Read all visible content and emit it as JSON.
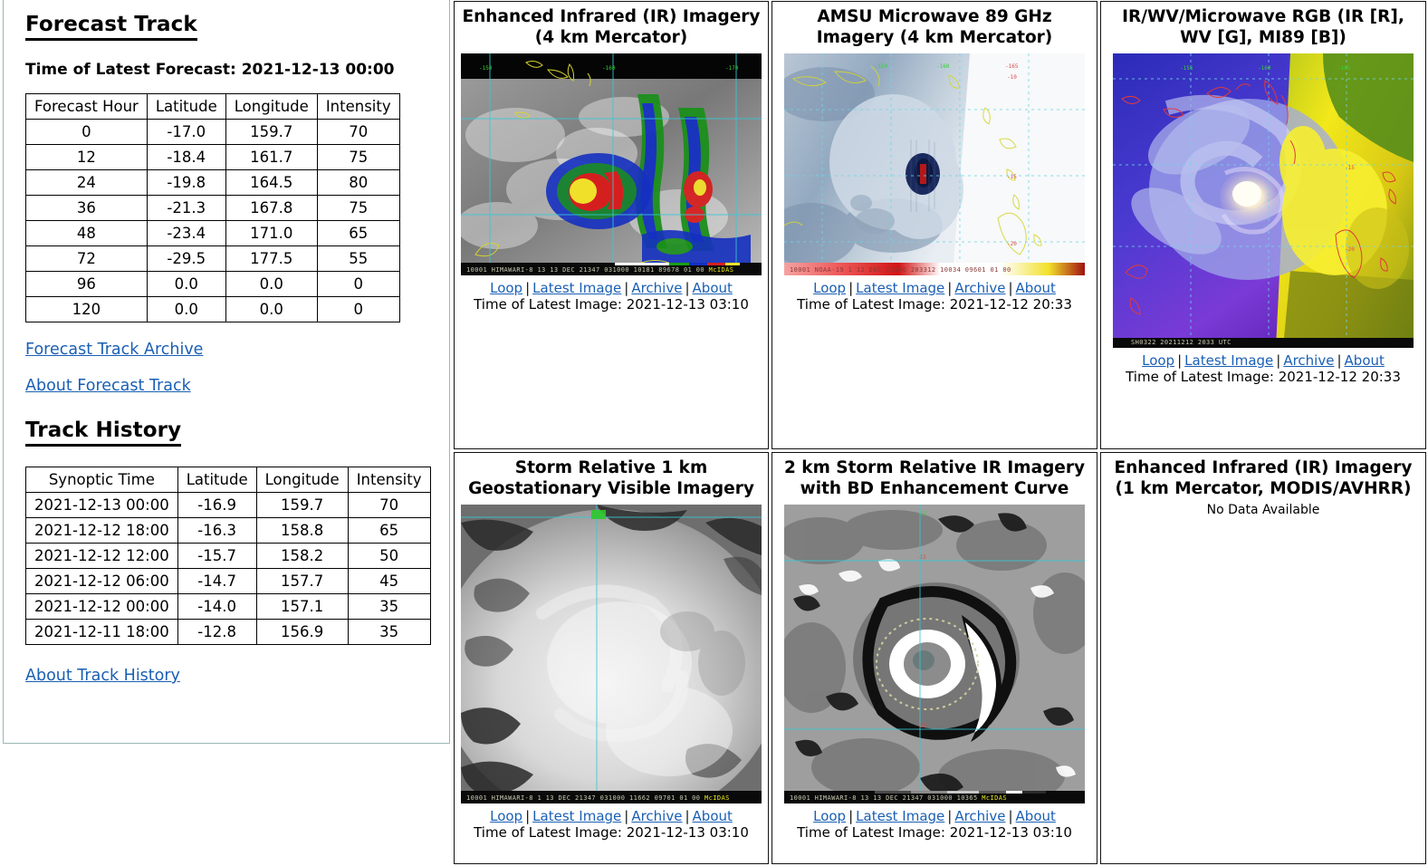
{
  "sidebar": {
    "forecast_track": {
      "heading": "Forecast Track",
      "latest_forecast_label": "Time of Latest Forecast: 2021-12-13 00:00",
      "columns": [
        "Forecast Hour",
        "Latitude",
        "Longitude",
        "Intensity"
      ],
      "rows": [
        [
          "0",
          "-17.0",
          "159.7",
          "70"
        ],
        [
          "12",
          "-18.4",
          "161.7",
          "75"
        ],
        [
          "24",
          "-19.8",
          "164.5",
          "80"
        ],
        [
          "36",
          "-21.3",
          "167.8",
          "75"
        ],
        [
          "48",
          "-23.4",
          "171.0",
          "65"
        ],
        [
          "72",
          "-29.5",
          "177.5",
          "55"
        ],
        [
          "96",
          "0.0",
          "0.0",
          "0"
        ],
        [
          "120",
          "0.0",
          "0.0",
          "0"
        ]
      ],
      "archive_link": "Forecast Track Archive",
      "about_link": "About Forecast Track"
    },
    "track_history": {
      "heading": "Track History",
      "columns": [
        "Synoptic Time",
        "Latitude",
        "Longitude",
        "Intensity"
      ],
      "rows": [
        [
          "2021-12-13 00:00",
          "-16.9",
          "159.7",
          "70"
        ],
        [
          "2021-12-12 18:00",
          "-16.3",
          "158.8",
          "65"
        ],
        [
          "2021-12-12 12:00",
          "-15.7",
          "158.2",
          "50"
        ],
        [
          "2021-12-12 06:00",
          "-14.7",
          "157.7",
          "45"
        ],
        [
          "2021-12-12 00:00",
          "-14.0",
          "157.1",
          "35"
        ],
        [
          "2021-12-11 18:00",
          "-12.8",
          "156.9",
          "35"
        ]
      ],
      "about_link": "About Track History"
    }
  },
  "common": {
    "loop_label": "Loop",
    "latest_image_label": "Latest Image",
    "archive_label": "Archive",
    "about_label": "About"
  },
  "panels": [
    {
      "id": "ir-4km",
      "title": "Enhanced Infrared (IR) Imagery (4 km Mercator)",
      "timestamp": "Time of Latest Image: 2021-12-13 03:10",
      "annotation": "10001 HIMAWARI-8 13 13 DEC 21347 031000 10181 89678 01 00",
      "annotation_suffix": "McIDAS",
      "lon_labels": [
        "-150",
        "-160",
        "-170"
      ],
      "has_data": true
    },
    {
      "id": "amsu-89ghz",
      "title": "AMSU Microwave 89 GHz Imagery (4 km Mercator)",
      "timestamp": "Time of Latest Image: 2021-12-12 20:33",
      "annotation": "10001 NOAA-19   1 12 DEC 21346 203312 10034 09601 01 00",
      "annotation_suffix": "",
      "lon_labels": [
        "-150",
        "-160"
      ],
      "lat_labels": [
        "-165",
        "-10",
        "-15",
        "-20"
      ],
      "has_data": true
    },
    {
      "id": "rgb-ir-wv-mi89",
      "title": "IR/WV/Microwave RGB (IR [R], WV [G], MI89 [B])",
      "timestamp": "Time of Latest Image: 2021-12-12 20:33",
      "annotation": "SH0322 20211212 2033 UTC",
      "annotation_suffix": "",
      "lat_labels": [
        "-155",
        "-160",
        "-165",
        "-15",
        "-20"
      ],
      "has_data": true
    },
    {
      "id": "visible-1km",
      "title": "Storm Relative 1 km Geostationary Visible Imagery",
      "timestamp": "Time of Latest Image: 2021-12-13 03:10",
      "annotation": "10001 HIMAWARI-8  1 13 DEC 21347 031000 11662 09701 01 00",
      "annotation_suffix": "McIDAS",
      "has_data": true
    },
    {
      "id": "ir-bd-2km",
      "title": "2 km Storm Relative IR Imagery with BD Enhancement Curve",
      "timestamp": "Time of Latest Image: 2021-12-13 03:10",
      "annotation": "10001 HIMAWARI-8 13 13 DEC 21347 031000 10365",
      "annotation_suffix": "McIDAS",
      "has_data": true
    },
    {
      "id": "ir-1km-modis",
      "title": "Enhanced Infrared (IR) Imagery (1 km Mercator, MODIS/AVHRR)",
      "no_data_label": "No Data Available",
      "has_data": false
    }
  ],
  "colors": {
    "link": "#1a5fb4",
    "text": "#000000",
    "panel_border": "#111111"
  }
}
